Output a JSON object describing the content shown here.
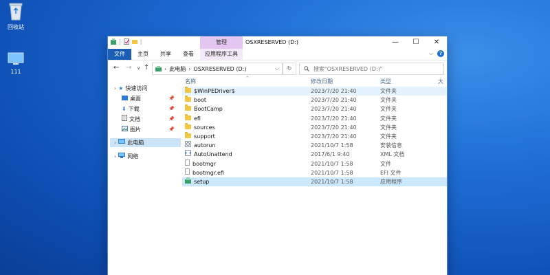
{
  "desktop": {
    "recycle_label": "回收站",
    "pc_label": "111"
  },
  "window": {
    "title": "OSXRESERVED (D:)",
    "context_tab": "管理",
    "ribbon_tabs": [
      "文件",
      "主页",
      "共享",
      "查看",
      "应用程序工具"
    ],
    "controls": {
      "minimize": "—",
      "maximize": "☐",
      "close": "✕"
    },
    "help": "?"
  },
  "address": {
    "back": "←",
    "forward": "→",
    "recent": "∨",
    "up": "↑",
    "crumbs": [
      "此电脑",
      "OSXRESERVED (D:)"
    ],
    "search_placeholder": "搜索\"OSXRESERVED (D:)\""
  },
  "nav": {
    "quick_access": "快速访问",
    "items": [
      "桌面",
      "下载",
      "文档",
      "图片"
    ],
    "this_pc": "此电脑",
    "network": "网络"
  },
  "columns": {
    "name": "名称",
    "date": "修改日期",
    "type": "类型",
    "size": "大"
  },
  "files": [
    {
      "name": "$WinPEDriver$",
      "date": "2023/7/20 21:40",
      "type": "文件夹",
      "icon": "folder"
    },
    {
      "name": "boot",
      "date": "2023/7/20 21:40",
      "type": "文件夹",
      "icon": "folder"
    },
    {
      "name": "BootCamp",
      "date": "2023/7/20 21:40",
      "type": "文件夹",
      "icon": "folder"
    },
    {
      "name": "efi",
      "date": "2023/7/20 21:40",
      "type": "文件夹",
      "icon": "folder"
    },
    {
      "name": "sources",
      "date": "2023/7/20 21:40",
      "type": "文件夹",
      "icon": "folder"
    },
    {
      "name": "support",
      "date": "2023/7/20 21:40",
      "type": "文件夹",
      "icon": "folder"
    },
    {
      "name": "autorun",
      "date": "2021/10/7 1:58",
      "type": "安装信息",
      "icon": "settings-file"
    },
    {
      "name": "AutoUnattend",
      "date": "2017/6/1 9:40",
      "type": "XML 文档",
      "icon": "xml-file"
    },
    {
      "name": "bootmgr",
      "date": "2021/10/7 1:58",
      "type": "文件",
      "icon": "file"
    },
    {
      "name": "bootmgr.efi",
      "date": "2021/10/7 1:58",
      "type": "EFI 文件",
      "icon": "file"
    },
    {
      "name": "setup",
      "date": "2021/10/7 1:58",
      "type": "应用程序",
      "icon": "setup-app"
    }
  ]
}
